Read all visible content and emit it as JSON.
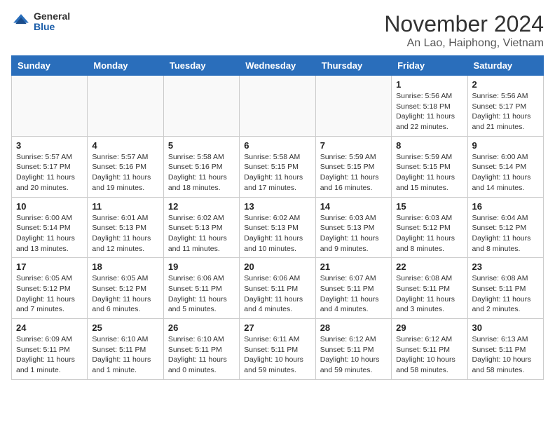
{
  "header": {
    "logo_general": "General",
    "logo_blue": "Blue",
    "title": "November 2024",
    "subtitle": "An Lao, Haiphong, Vietnam"
  },
  "weekdays": [
    "Sunday",
    "Monday",
    "Tuesday",
    "Wednesday",
    "Thursday",
    "Friday",
    "Saturday"
  ],
  "weeks": [
    [
      {
        "day": "",
        "info": ""
      },
      {
        "day": "",
        "info": ""
      },
      {
        "day": "",
        "info": ""
      },
      {
        "day": "",
        "info": ""
      },
      {
        "day": "",
        "info": ""
      },
      {
        "day": "1",
        "info": "Sunrise: 5:56 AM\nSunset: 5:18 PM\nDaylight: 11 hours\nand 22 minutes."
      },
      {
        "day": "2",
        "info": "Sunrise: 5:56 AM\nSunset: 5:17 PM\nDaylight: 11 hours\nand 21 minutes."
      }
    ],
    [
      {
        "day": "3",
        "info": "Sunrise: 5:57 AM\nSunset: 5:17 PM\nDaylight: 11 hours\nand 20 minutes."
      },
      {
        "day": "4",
        "info": "Sunrise: 5:57 AM\nSunset: 5:16 PM\nDaylight: 11 hours\nand 19 minutes."
      },
      {
        "day": "5",
        "info": "Sunrise: 5:58 AM\nSunset: 5:16 PM\nDaylight: 11 hours\nand 18 minutes."
      },
      {
        "day": "6",
        "info": "Sunrise: 5:58 AM\nSunset: 5:15 PM\nDaylight: 11 hours\nand 17 minutes."
      },
      {
        "day": "7",
        "info": "Sunrise: 5:59 AM\nSunset: 5:15 PM\nDaylight: 11 hours\nand 16 minutes."
      },
      {
        "day": "8",
        "info": "Sunrise: 5:59 AM\nSunset: 5:15 PM\nDaylight: 11 hours\nand 15 minutes."
      },
      {
        "day": "9",
        "info": "Sunrise: 6:00 AM\nSunset: 5:14 PM\nDaylight: 11 hours\nand 14 minutes."
      }
    ],
    [
      {
        "day": "10",
        "info": "Sunrise: 6:00 AM\nSunset: 5:14 PM\nDaylight: 11 hours\nand 13 minutes."
      },
      {
        "day": "11",
        "info": "Sunrise: 6:01 AM\nSunset: 5:13 PM\nDaylight: 11 hours\nand 12 minutes."
      },
      {
        "day": "12",
        "info": "Sunrise: 6:02 AM\nSunset: 5:13 PM\nDaylight: 11 hours\nand 11 minutes."
      },
      {
        "day": "13",
        "info": "Sunrise: 6:02 AM\nSunset: 5:13 PM\nDaylight: 11 hours\nand 10 minutes."
      },
      {
        "day": "14",
        "info": "Sunrise: 6:03 AM\nSunset: 5:13 PM\nDaylight: 11 hours\nand 9 minutes."
      },
      {
        "day": "15",
        "info": "Sunrise: 6:03 AM\nSunset: 5:12 PM\nDaylight: 11 hours\nand 8 minutes."
      },
      {
        "day": "16",
        "info": "Sunrise: 6:04 AM\nSunset: 5:12 PM\nDaylight: 11 hours\nand 8 minutes."
      }
    ],
    [
      {
        "day": "17",
        "info": "Sunrise: 6:05 AM\nSunset: 5:12 PM\nDaylight: 11 hours\nand 7 minutes."
      },
      {
        "day": "18",
        "info": "Sunrise: 6:05 AM\nSunset: 5:12 PM\nDaylight: 11 hours\nand 6 minutes."
      },
      {
        "day": "19",
        "info": "Sunrise: 6:06 AM\nSunset: 5:11 PM\nDaylight: 11 hours\nand 5 minutes."
      },
      {
        "day": "20",
        "info": "Sunrise: 6:06 AM\nSunset: 5:11 PM\nDaylight: 11 hours\nand 4 minutes."
      },
      {
        "day": "21",
        "info": "Sunrise: 6:07 AM\nSunset: 5:11 PM\nDaylight: 11 hours\nand 4 minutes."
      },
      {
        "day": "22",
        "info": "Sunrise: 6:08 AM\nSunset: 5:11 PM\nDaylight: 11 hours\nand 3 minutes."
      },
      {
        "day": "23",
        "info": "Sunrise: 6:08 AM\nSunset: 5:11 PM\nDaylight: 11 hours\nand 2 minutes."
      }
    ],
    [
      {
        "day": "24",
        "info": "Sunrise: 6:09 AM\nSunset: 5:11 PM\nDaylight: 11 hours\nand 1 minute."
      },
      {
        "day": "25",
        "info": "Sunrise: 6:10 AM\nSunset: 5:11 PM\nDaylight: 11 hours\nand 1 minute."
      },
      {
        "day": "26",
        "info": "Sunrise: 6:10 AM\nSunset: 5:11 PM\nDaylight: 11 hours\nand 0 minutes."
      },
      {
        "day": "27",
        "info": "Sunrise: 6:11 AM\nSunset: 5:11 PM\nDaylight: 10 hours\nand 59 minutes."
      },
      {
        "day": "28",
        "info": "Sunrise: 6:12 AM\nSunset: 5:11 PM\nDaylight: 10 hours\nand 59 minutes."
      },
      {
        "day": "29",
        "info": "Sunrise: 6:12 AM\nSunset: 5:11 PM\nDaylight: 10 hours\nand 58 minutes."
      },
      {
        "day": "30",
        "info": "Sunrise: 6:13 AM\nSunset: 5:11 PM\nDaylight: 10 hours\nand 58 minutes."
      }
    ]
  ]
}
